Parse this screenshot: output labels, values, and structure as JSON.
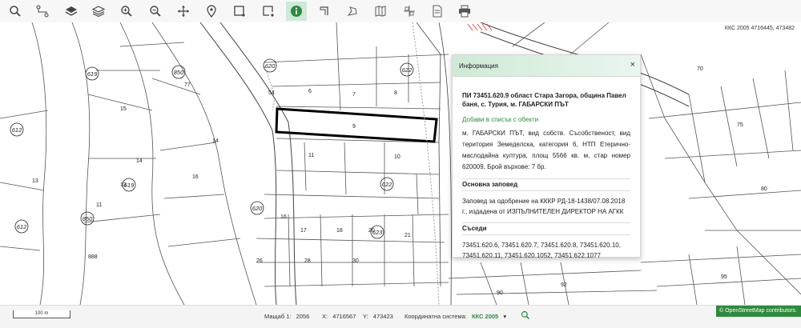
{
  "toolbar": {
    "icons": [
      "search-icon",
      "route-icon",
      "layers-icon",
      "layers-stack-icon",
      "zoom-in-icon",
      "zoom-out-icon",
      "pan-icon",
      "location-pin-icon",
      "select-rect-icon",
      "select-rect-alt-icon",
      "info-icon",
      "bookmark-icon",
      "measure-icon",
      "map-icon",
      "crosshair-icon",
      "document-icon",
      "print-icon"
    ]
  },
  "map": {
    "coord_label": "ККС 2005 4716445, 473482",
    "circled_labels": [
      "619",
      "850",
      "612",
      "620",
      "622",
      "619",
      "850",
      "612",
      "620",
      "622",
      "623"
    ],
    "scale_text": "100 m"
  },
  "panel": {
    "header": "Информация",
    "close": "×",
    "title": "ПИ 73451.620.9 област Стара Загора, община Павел баня, с. Турия, м. ГАБАРСКИ ПЪТ",
    "add_link": "Добави в списък с обекти",
    "description": "м. ГАБАРСКИ ПЪТ, вид собств. Съсобственост, вид територия Земеделска, категория 6, НТП Етерично-маслодайна култура, площ 5566 кв. м, стар номер 620009, Брой върхове: 7 бр.",
    "order_heading": "Основна заповед",
    "order_text": "Заповед за одобрение на КККР РД-18-1438/07.08.2018 г., издадена от ИЗПЪЛНИТЕЛЕН ДИРЕКТОР НА АГКК",
    "neighbors_heading": "Съседи",
    "neighbors_text": "73451.620.6, 73451.620.7, 73451.620.8, 73451.620.10, 73451.620.11, 73451.620.1052, 73451.622.1077"
  },
  "bottom": {
    "scale_label": "Мащаб 1:",
    "scale_value": "2056",
    "x_label": "X:",
    "x_value": "4716567",
    "y_label": "Y:",
    "y_value": "473423",
    "crs_label": "Координатна система:",
    "crs_value": "ККС 2005",
    "osm_text": "© OpenStreetMap contributors."
  }
}
